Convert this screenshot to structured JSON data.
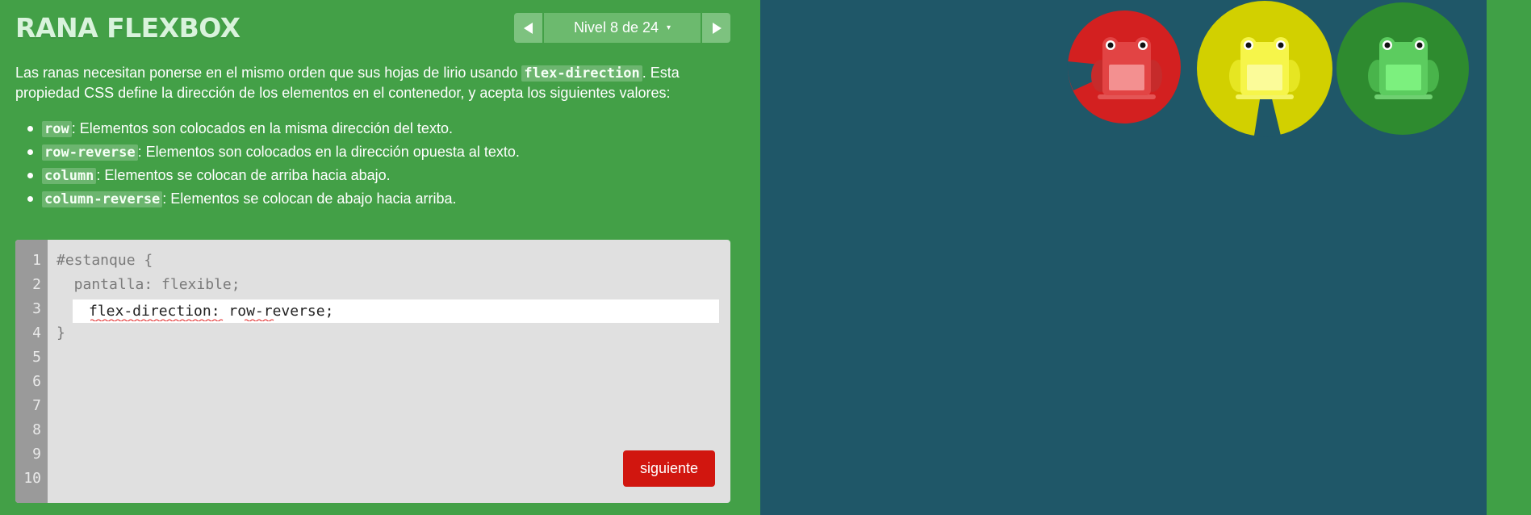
{
  "app": {
    "title": "RANA FLEXBOX"
  },
  "level_nav": {
    "prev_icon": "triangle-left-icon",
    "label": "Nivel 8 de 24",
    "caret": "▾",
    "next_icon": "triangle-right-icon"
  },
  "instructions": {
    "before": "Las ranas necesitan ponerse en el mismo orden que sus hojas de lirio usando ",
    "keyword": "flex-direction",
    "after": ". Esta propiedad CSS define la dirección de los elementos en el contenedor, y acepta los siguientes valores:"
  },
  "values": [
    {
      "code": "row",
      "desc": ": Elementos son colocados en la misma dirección del texto."
    },
    {
      "code": "row-reverse",
      "desc": ": Elementos son colocados en la dirección opuesta al texto."
    },
    {
      "code": "column",
      "desc": ": Elementos se colocan de arriba hacia abajo."
    },
    {
      "code": "column-reverse",
      "desc": ": Elementos se colocan de abajo hacia arriba."
    }
  ],
  "editor": {
    "line_numbers": [
      "1",
      "2",
      "3",
      "4",
      "5",
      "6",
      "7",
      "8",
      "9",
      "10"
    ],
    "line1": "#estanque {",
    "line2": "  pantalla: flexible;",
    "input_value": "flex-direction: row-reverse;",
    "line4": "}",
    "next_button": "siguiente"
  },
  "board": {
    "pads": [
      "red",
      "yellow",
      "green"
    ],
    "frogs": [
      "red",
      "yellow",
      "green"
    ]
  },
  "colors": {
    "sidebar_bg": "#43a047",
    "board_bg": "#1f5768",
    "red": "#d32020",
    "yellow": "#d2d000",
    "green": "#2e8b2f",
    "next_button": "#d1160f"
  }
}
